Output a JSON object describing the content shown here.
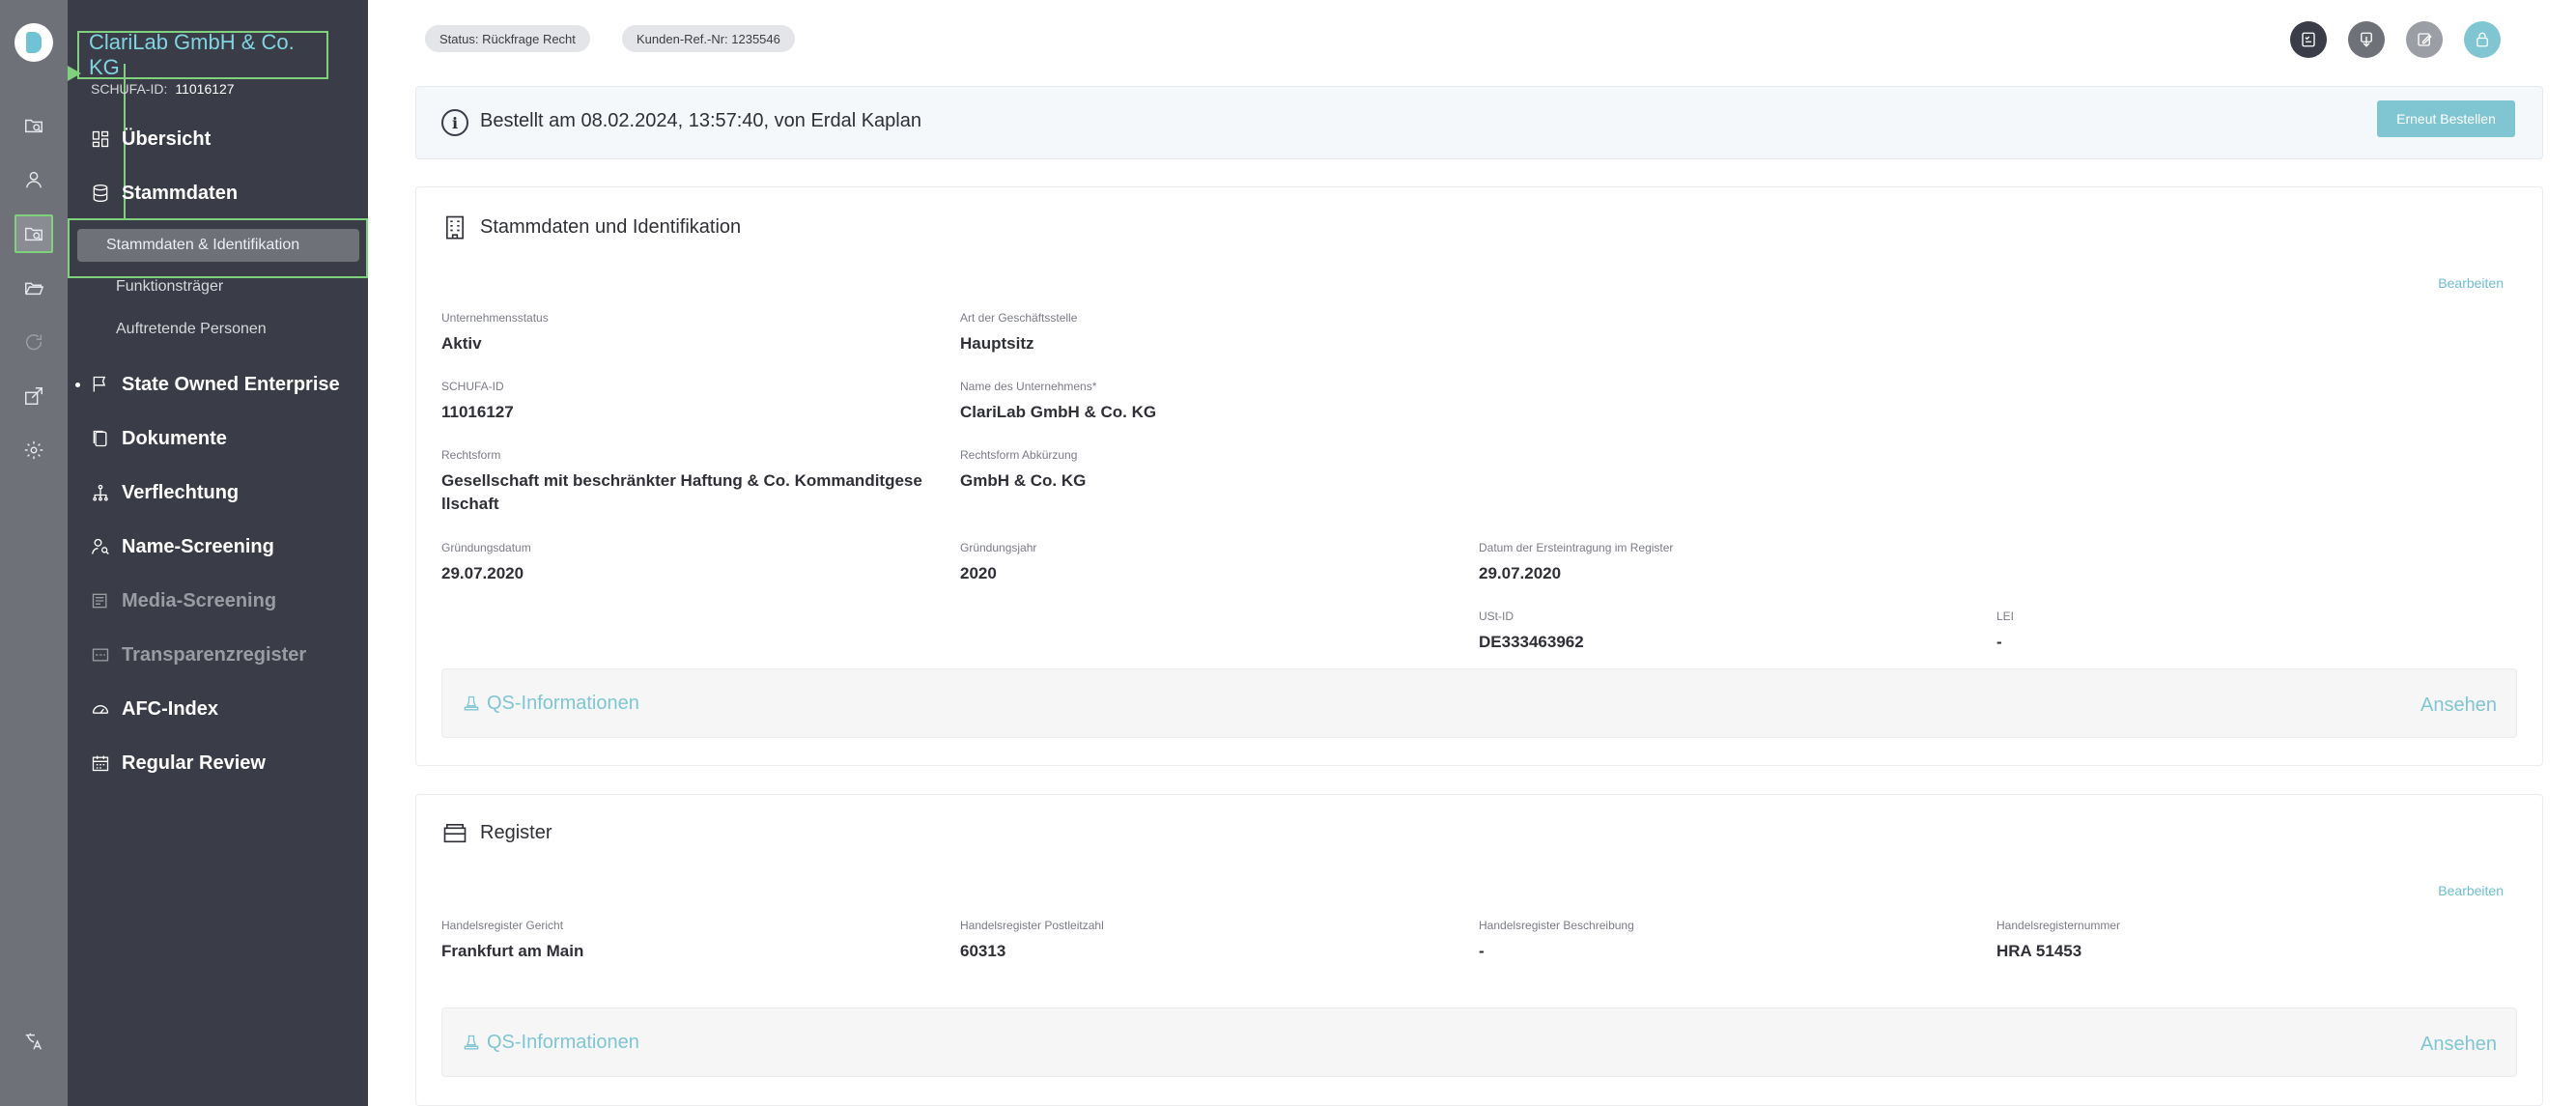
{
  "rail": {
    "icons": [
      "folder-search-icon",
      "person-icon",
      "folder-search-icon",
      "folder-open-icon",
      "refresh-icon",
      "export-icon",
      "gear-icon",
      "translate-icon"
    ]
  },
  "sidebar": {
    "company_name": "ClariLab GmbH & Co. KG",
    "schufa_label": "SCHUFA-ID:",
    "schufa_id": "11016127",
    "items": [
      {
        "label": "Übersicht",
        "icon": "dashboard-icon"
      },
      {
        "label": "Stammdaten",
        "icon": "database-icon"
      },
      {
        "label": "State Owned Enterprise",
        "icon": "flag-icon"
      },
      {
        "label": "Dokumente",
        "icon": "document-icon"
      },
      {
        "label": "Verflechtung",
        "icon": "network-icon"
      },
      {
        "label": "Name-Screening",
        "icon": "person-search-icon"
      },
      {
        "label": "Media-Screening",
        "icon": "newspaper-icon"
      },
      {
        "label": "Transparenzregister",
        "icon": "register-icon"
      },
      {
        "label": "AFC-Index",
        "icon": "gauge-icon"
      },
      {
        "label": "Regular Review",
        "icon": "calendar-icon"
      }
    ],
    "subitems": [
      "Stammdaten & Identifikation",
      "Funktionsträger",
      "Auftretende Personen"
    ]
  },
  "header": {
    "status": "Status: Rückfrage Recht",
    "ref": "Kunden-Ref.-Nr: 1235546"
  },
  "banner": {
    "text": "Bestellt am 08.02.2024, 13:57:40, von Erdal Kaplan",
    "reorder_label": "Erneut Bestellen"
  },
  "card_stamm": {
    "title": "Stammdaten und Identifikation",
    "edit": "Bearbeiten",
    "fields": {
      "status_lbl": "Unternehmensstatus",
      "status_val": "Aktiv",
      "art_lbl": "Art der Geschäftsstelle",
      "art_val": "Hauptsitz",
      "schufa_lbl": "SCHUFA-ID",
      "schufa_val": "11016127",
      "name_lbl": "Name des Unternehmens*",
      "name_val": "ClariLab GmbH & Co. KG",
      "rechtsform_lbl": "Rechtsform",
      "rechtsform_val": "Gesellschaft mit beschränkter Haftung & Co. Kommanditgesellschaft",
      "abk_lbl": "Rechtsform Abkürzung",
      "abk_val": "GmbH & Co. KG",
      "gdatum_lbl": "Gründungsdatum",
      "gdatum_val": "29.07.2020",
      "gjahr_lbl": "Gründungsjahr",
      "gjahr_val": "2020",
      "erst_lbl": "Datum der Ersteintragung im Register",
      "erst_val": "29.07.2020",
      "ust_lbl": "USt-ID",
      "ust_val": "DE333463962",
      "lei_lbl": "LEI",
      "lei_val": "-"
    },
    "qs_label": "QS-Informationen",
    "qs_view": "Ansehen"
  },
  "card_register": {
    "title": "Register",
    "edit": "Bearbeiten",
    "fields": {
      "gericht_lbl": "Handelsregister Gericht",
      "gericht_val": "Frankfurt am Main",
      "plz_lbl": "Handelsregister Postleitzahl",
      "plz_val": "60313",
      "beschr_lbl": "Handelsregister Beschreibung",
      "beschr_val": "-",
      "nummer_lbl": "Handelsregisternummer",
      "nummer_val": "HRA 51453"
    },
    "qs_label": "QS-Informationen",
    "qs_view": "Ansehen"
  },
  "colors": {
    "accent": "#7fc6d2",
    "sidebar": "#3a3c47",
    "rail": "#6f7178",
    "highlight": "#7fd17c"
  }
}
